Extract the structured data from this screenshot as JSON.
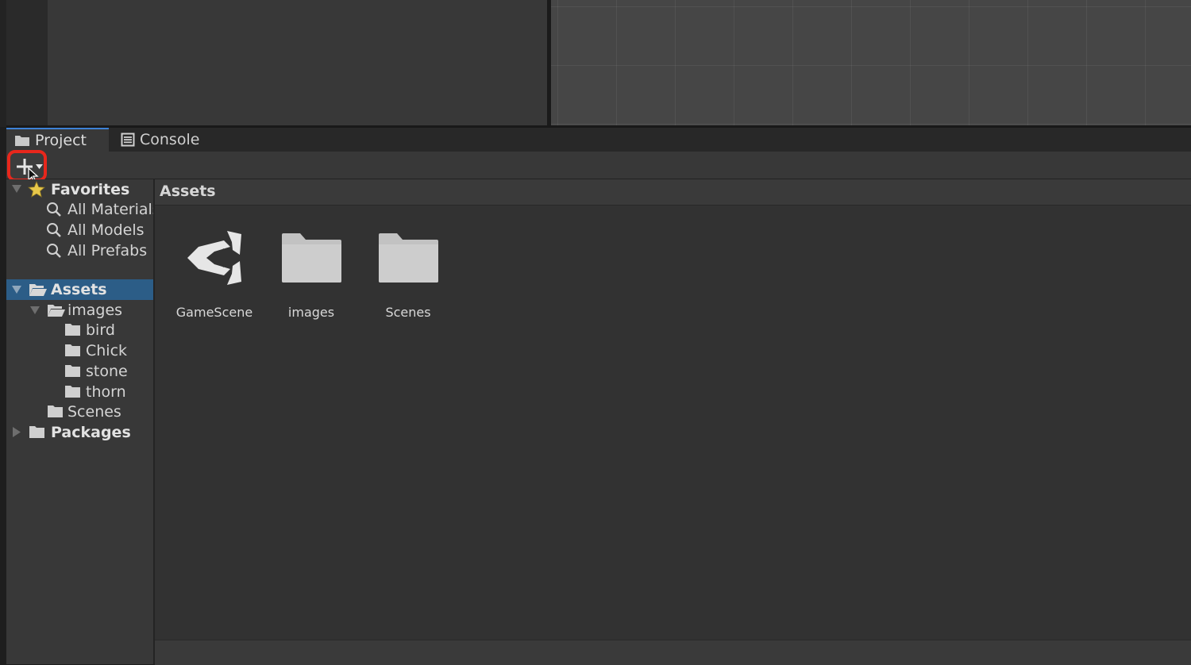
{
  "tabs": [
    {
      "label": "Project",
      "icon": "folder-icon",
      "active": true
    },
    {
      "label": "Console",
      "icon": "console-icon",
      "active": false
    }
  ],
  "toolbar": {
    "add_icon": "plus-icon",
    "add_dropdown_icon": "caret-down-icon"
  },
  "tree": {
    "favorites": {
      "label": "Favorites",
      "icon": "star-icon",
      "items": [
        {
          "label": "All Materials",
          "icon": "search-icon"
        },
        {
          "label": "All Models",
          "icon": "search-icon"
        },
        {
          "label": "All Prefabs",
          "icon": "search-icon"
        }
      ]
    },
    "assets": {
      "label": "Assets",
      "icon": "folder-open-icon",
      "selected": true,
      "images": {
        "label": "images",
        "icon": "folder-open-icon",
        "children": [
          {
            "label": "bird"
          },
          {
            "label": "Chick"
          },
          {
            "label": "stone"
          },
          {
            "label": "thorn"
          }
        ]
      },
      "scenes": {
        "label": "Scenes"
      }
    },
    "packages": {
      "label": "Packages",
      "icon": "folder-icon"
    }
  },
  "content": {
    "breadcrumb": "Assets",
    "items": [
      {
        "name": "GameScene",
        "icon": "unity-scene-icon"
      },
      {
        "name": "images",
        "icon": "folder-icon"
      },
      {
        "name": "Scenes",
        "icon": "folder-icon"
      }
    ]
  },
  "colors": {
    "highlight": "#e8271c",
    "selection": "#2c5d87",
    "tab_accent": "#3d82d6"
  }
}
